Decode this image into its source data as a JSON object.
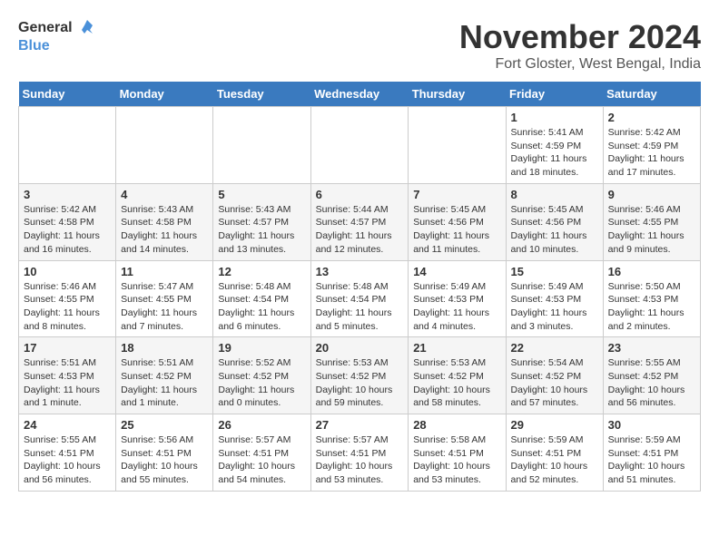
{
  "logo": {
    "line1": "General",
    "line2": "Blue"
  },
  "title": "November 2024",
  "subtitle": "Fort Gloster, West Bengal, India",
  "headers": [
    "Sunday",
    "Monday",
    "Tuesday",
    "Wednesday",
    "Thursday",
    "Friday",
    "Saturday"
  ],
  "weeks": [
    [
      {
        "day": "",
        "info": ""
      },
      {
        "day": "",
        "info": ""
      },
      {
        "day": "",
        "info": ""
      },
      {
        "day": "",
        "info": ""
      },
      {
        "day": "",
        "info": ""
      },
      {
        "day": "1",
        "info": "Sunrise: 5:41 AM\nSunset: 4:59 PM\nDaylight: 11 hours and 18 minutes."
      },
      {
        "day": "2",
        "info": "Sunrise: 5:42 AM\nSunset: 4:59 PM\nDaylight: 11 hours and 17 minutes."
      }
    ],
    [
      {
        "day": "3",
        "info": "Sunrise: 5:42 AM\nSunset: 4:58 PM\nDaylight: 11 hours and 16 minutes."
      },
      {
        "day": "4",
        "info": "Sunrise: 5:43 AM\nSunset: 4:58 PM\nDaylight: 11 hours and 14 minutes."
      },
      {
        "day": "5",
        "info": "Sunrise: 5:43 AM\nSunset: 4:57 PM\nDaylight: 11 hours and 13 minutes."
      },
      {
        "day": "6",
        "info": "Sunrise: 5:44 AM\nSunset: 4:57 PM\nDaylight: 11 hours and 12 minutes."
      },
      {
        "day": "7",
        "info": "Sunrise: 5:45 AM\nSunset: 4:56 PM\nDaylight: 11 hours and 11 minutes."
      },
      {
        "day": "8",
        "info": "Sunrise: 5:45 AM\nSunset: 4:56 PM\nDaylight: 11 hours and 10 minutes."
      },
      {
        "day": "9",
        "info": "Sunrise: 5:46 AM\nSunset: 4:55 PM\nDaylight: 11 hours and 9 minutes."
      }
    ],
    [
      {
        "day": "10",
        "info": "Sunrise: 5:46 AM\nSunset: 4:55 PM\nDaylight: 11 hours and 8 minutes."
      },
      {
        "day": "11",
        "info": "Sunrise: 5:47 AM\nSunset: 4:55 PM\nDaylight: 11 hours and 7 minutes."
      },
      {
        "day": "12",
        "info": "Sunrise: 5:48 AM\nSunset: 4:54 PM\nDaylight: 11 hours and 6 minutes."
      },
      {
        "day": "13",
        "info": "Sunrise: 5:48 AM\nSunset: 4:54 PM\nDaylight: 11 hours and 5 minutes."
      },
      {
        "day": "14",
        "info": "Sunrise: 5:49 AM\nSunset: 4:53 PM\nDaylight: 11 hours and 4 minutes."
      },
      {
        "day": "15",
        "info": "Sunrise: 5:49 AM\nSunset: 4:53 PM\nDaylight: 11 hours and 3 minutes."
      },
      {
        "day": "16",
        "info": "Sunrise: 5:50 AM\nSunset: 4:53 PM\nDaylight: 11 hours and 2 minutes."
      }
    ],
    [
      {
        "day": "17",
        "info": "Sunrise: 5:51 AM\nSunset: 4:53 PM\nDaylight: 11 hours and 1 minute."
      },
      {
        "day": "18",
        "info": "Sunrise: 5:51 AM\nSunset: 4:52 PM\nDaylight: 11 hours and 1 minute."
      },
      {
        "day": "19",
        "info": "Sunrise: 5:52 AM\nSunset: 4:52 PM\nDaylight: 11 hours and 0 minutes."
      },
      {
        "day": "20",
        "info": "Sunrise: 5:53 AM\nSunset: 4:52 PM\nDaylight: 10 hours and 59 minutes."
      },
      {
        "day": "21",
        "info": "Sunrise: 5:53 AM\nSunset: 4:52 PM\nDaylight: 10 hours and 58 minutes."
      },
      {
        "day": "22",
        "info": "Sunrise: 5:54 AM\nSunset: 4:52 PM\nDaylight: 10 hours and 57 minutes."
      },
      {
        "day": "23",
        "info": "Sunrise: 5:55 AM\nSunset: 4:52 PM\nDaylight: 10 hours and 56 minutes."
      }
    ],
    [
      {
        "day": "24",
        "info": "Sunrise: 5:55 AM\nSunset: 4:51 PM\nDaylight: 10 hours and 56 minutes."
      },
      {
        "day": "25",
        "info": "Sunrise: 5:56 AM\nSunset: 4:51 PM\nDaylight: 10 hours and 55 minutes."
      },
      {
        "day": "26",
        "info": "Sunrise: 5:57 AM\nSunset: 4:51 PM\nDaylight: 10 hours and 54 minutes."
      },
      {
        "day": "27",
        "info": "Sunrise: 5:57 AM\nSunset: 4:51 PM\nDaylight: 10 hours and 53 minutes."
      },
      {
        "day": "28",
        "info": "Sunrise: 5:58 AM\nSunset: 4:51 PM\nDaylight: 10 hours and 53 minutes."
      },
      {
        "day": "29",
        "info": "Sunrise: 5:59 AM\nSunset: 4:51 PM\nDaylight: 10 hours and 52 minutes."
      },
      {
        "day": "30",
        "info": "Sunrise: 5:59 AM\nSunset: 4:51 PM\nDaylight: 10 hours and 51 minutes."
      }
    ]
  ]
}
